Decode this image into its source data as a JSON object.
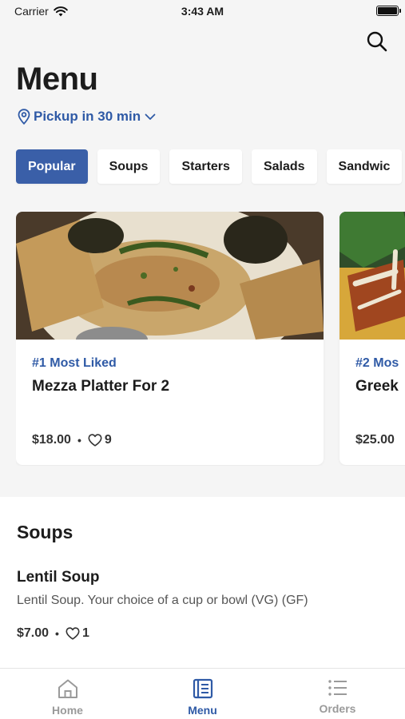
{
  "status_bar": {
    "carrier": "Carrier",
    "time": "3:43 AM"
  },
  "header": {
    "title": "Menu",
    "pickup_label": "Pickup in 30 min"
  },
  "categories": [
    {
      "label": "Popular",
      "active": true
    },
    {
      "label": "Soups",
      "active": false
    },
    {
      "label": "Starters",
      "active": false
    },
    {
      "label": "Salads",
      "active": false
    },
    {
      "label": "Sandwic",
      "active": false
    }
  ],
  "featured": [
    {
      "rank": "#1 Most Liked",
      "name": "Mezza Platter For 2",
      "price": "$18.00",
      "likes": "9"
    },
    {
      "rank": "#2 Mos",
      "name": "Greek",
      "price": "$25.00",
      "likes": ""
    }
  ],
  "soups": {
    "title": "Soups",
    "items": [
      {
        "name": "Lentil Soup",
        "description": "Lentil Soup. Your choice of a cup or bowl (VG) (GF)",
        "price": "$7.00",
        "likes": "1"
      }
    ]
  },
  "tabs": [
    {
      "label": "Home",
      "icon": "home-icon"
    },
    {
      "label": "Menu",
      "icon": "menu-book-icon"
    },
    {
      "label": "Orders",
      "icon": "list-icon"
    }
  ],
  "colors": {
    "accent": "#3a5fa8",
    "link": "#2f5aa6",
    "inactive_tab": "#9a9a9a",
    "background": "#f5f5f5"
  }
}
